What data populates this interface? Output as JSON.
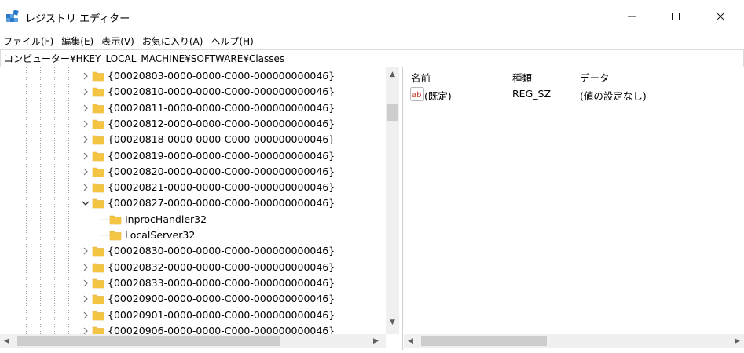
{
  "window": {
    "title": "レジストリ エディター",
    "icon": "registry-editor-icon"
  },
  "menu": [
    "ファイル(F)",
    "編集(E)",
    "表示(V)",
    "お気に入り(A)",
    "ヘルプ(H)"
  ],
  "address": "コンピューター¥HKEY_LOCAL_MACHINE¥SOFTWARE¥Classes",
  "tree": {
    "rows": [
      {
        "label": "{00020803-0000-0000-C000-000000000046}",
        "state": "collapsed"
      },
      {
        "label": "{00020810-0000-0000-C000-000000000046}",
        "state": "collapsed"
      },
      {
        "label": "{00020811-0000-0000-C000-000000000046}",
        "state": "collapsed"
      },
      {
        "label": "{00020812-0000-0000-C000-000000000046}",
        "state": "collapsed"
      },
      {
        "label": "{00020818-0000-0000-C000-000000000046}",
        "state": "collapsed"
      },
      {
        "label": "{00020819-0000-0000-C000-000000000046}",
        "state": "collapsed"
      },
      {
        "label": "{00020820-0000-0000-C000-000000000046}",
        "state": "collapsed"
      },
      {
        "label": "{00020821-0000-0000-C000-000000000046}",
        "state": "collapsed"
      },
      {
        "label": "{00020827-0000-0000-C000-000000000046}",
        "state": "expanded"
      },
      {
        "label": "InprocHandler32",
        "state": "child"
      },
      {
        "label": "LocalServer32",
        "state": "child"
      },
      {
        "label": "{00020830-0000-0000-C000-000000000046}",
        "state": "collapsed"
      },
      {
        "label": "{00020832-0000-0000-C000-000000000046}",
        "state": "collapsed"
      },
      {
        "label": "{00020833-0000-0000-C000-000000000046}",
        "state": "collapsed"
      },
      {
        "label": "{00020900-0000-0000-C000-000000000046}",
        "state": "collapsed"
      },
      {
        "label": "{00020901-0000-0000-C000-000000000046}",
        "state": "collapsed"
      },
      {
        "label": "{00020906-0000-0000-C000-000000000046}",
        "state": "collapsed"
      }
    ]
  },
  "list": {
    "columns": [
      "名前",
      "種類",
      "データ"
    ],
    "rows": [
      {
        "name": "(既定)",
        "type": "REG_SZ",
        "data": "(値の設定なし)"
      }
    ]
  },
  "colors": {
    "folder": "#f4c542",
    "folder_dark": "#e0a92b",
    "icon_blue": "#2b78c5"
  }
}
